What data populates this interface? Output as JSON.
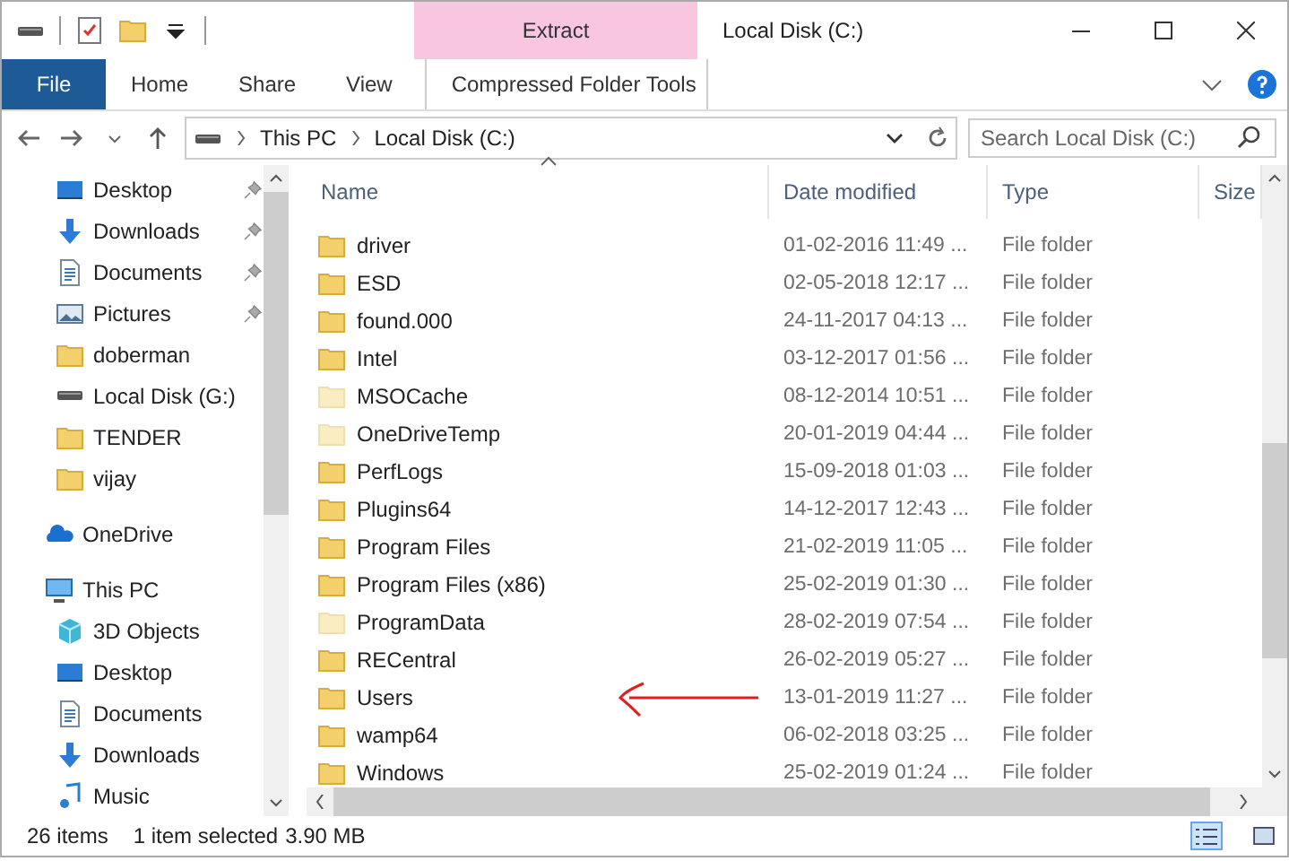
{
  "window": {
    "title": "Local Disk (C:)"
  },
  "ribbon": {
    "context_group": "Extract",
    "tabs": [
      {
        "label": "File",
        "kind": "file"
      },
      {
        "label": "Home",
        "kind": "normal"
      },
      {
        "label": "Share",
        "kind": "normal"
      },
      {
        "label": "View",
        "kind": "normal"
      },
      {
        "label": "Compressed Folder Tools",
        "kind": "contextual"
      }
    ]
  },
  "address": {
    "crumbs": [
      "This PC",
      "Local Disk (C:)"
    ],
    "search_placeholder": "Search Local Disk (C:)"
  },
  "nav": {
    "quick_access": [
      {
        "label": "Desktop",
        "kind": "desktop",
        "pinned": true
      },
      {
        "label": "Downloads",
        "kind": "downloads",
        "pinned": true
      },
      {
        "label": "Documents",
        "kind": "documents",
        "pinned": true
      },
      {
        "label": "Pictures",
        "kind": "pictures",
        "pinned": true
      },
      {
        "label": "doberman",
        "kind": "folder",
        "pinned": false
      },
      {
        "label": "Local Disk (G:)",
        "kind": "drive",
        "pinned": false
      },
      {
        "label": "TENDER",
        "kind": "folder",
        "pinned": false
      },
      {
        "label": "vijay",
        "kind": "folder",
        "pinned": false
      }
    ],
    "roots": [
      {
        "label": "OneDrive",
        "kind": "cloud"
      },
      {
        "label": "This PC",
        "kind": "pc",
        "children": [
          {
            "label": "3D Objects",
            "kind": "cube"
          },
          {
            "label": "Desktop",
            "kind": "desktop"
          },
          {
            "label": "Documents",
            "kind": "documents"
          },
          {
            "label": "Downloads",
            "kind": "downloads"
          },
          {
            "label": "Music",
            "kind": "music"
          }
        ]
      }
    ]
  },
  "table": {
    "columns": [
      "Name",
      "Date modified",
      "Type",
      "Size"
    ],
    "rows": [
      {
        "name": "driver",
        "date": "01-02-2016 11:49 ...",
        "type": "File folder",
        "hidden": false
      },
      {
        "name": "ESD",
        "date": "02-05-2018 12:17 ...",
        "type": "File folder",
        "hidden": false
      },
      {
        "name": "found.000",
        "date": "24-11-2017 04:13 ...",
        "type": "File folder",
        "hidden": false
      },
      {
        "name": "Intel",
        "date": "03-12-2017 01:56 ...",
        "type": "File folder",
        "hidden": false
      },
      {
        "name": "MSOCache",
        "date": "08-12-2014 10:51 ...",
        "type": "File folder",
        "hidden": true
      },
      {
        "name": "OneDriveTemp",
        "date": "20-01-2019 04:44 ...",
        "type": "File folder",
        "hidden": true
      },
      {
        "name": "PerfLogs",
        "date": "15-09-2018 01:03 ...",
        "type": "File folder",
        "hidden": false
      },
      {
        "name": "Plugins64",
        "date": "14-12-2017 12:43 ...",
        "type": "File folder",
        "hidden": false
      },
      {
        "name": "Program Files",
        "date": "21-02-2019 11:05 ...",
        "type": "File folder",
        "hidden": false
      },
      {
        "name": "Program Files (x86)",
        "date": "25-02-2019 01:30 ...",
        "type": "File folder",
        "hidden": false
      },
      {
        "name": "ProgramData",
        "date": "28-02-2019 07:54 ...",
        "type": "File folder",
        "hidden": true
      },
      {
        "name": "RECentral",
        "date": "26-02-2019 05:27 ...",
        "type": "File folder",
        "hidden": false
      },
      {
        "name": "Users",
        "date": "13-01-2019 11:27 ...",
        "type": "File folder",
        "hidden": false
      },
      {
        "name": "wamp64",
        "date": "06-02-2018 03:25 ...",
        "type": "File folder",
        "hidden": false
      },
      {
        "name": "Windows",
        "date": "25-02-2019 01:24 ...",
        "type": "File folder",
        "hidden": false
      }
    ]
  },
  "status_bar": {
    "count": "26 items",
    "selection": "1 item selected",
    "size": "3.90 MB"
  }
}
